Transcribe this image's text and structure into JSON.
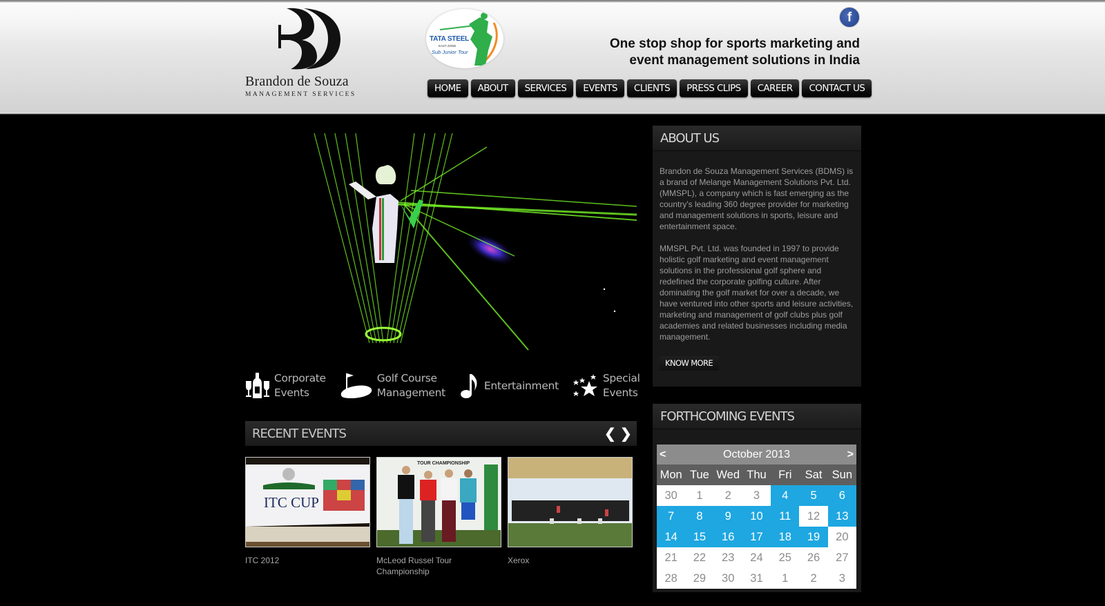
{
  "brand": {
    "name": "Brandon de Souza",
    "subtitle": "MANAGEMENT SERVICES",
    "partner_badge": {
      "line1": "TATA STEEL",
      "line2": "EAST ZONE",
      "line3": "Sub Junior Tour"
    }
  },
  "header": {
    "social_icon": "facebook-icon",
    "social_label": "f",
    "tagline_line1": "One stop shop for sports marketing and",
    "tagline_line2": "event management solutions in India"
  },
  "nav": {
    "items": [
      {
        "label": "HOME"
      },
      {
        "label": "ABOUT"
      },
      {
        "label": "SERVICES"
      },
      {
        "label": "EVENTS"
      },
      {
        "label": "CLIENTS"
      },
      {
        "label": "PRESS CLIPS"
      },
      {
        "label": "CAREER"
      },
      {
        "label": "CONTACT US"
      }
    ]
  },
  "services": [
    {
      "icon": "wine-glasses-icon",
      "line1": "Corporate",
      "line2": "Events"
    },
    {
      "icon": "golf-green-icon",
      "line1": "Golf Course",
      "line2": "Management"
    },
    {
      "icon": "music-note-icon",
      "line1": "Entertainment",
      "line2": ""
    },
    {
      "icon": "stars-icon",
      "line1": "Special",
      "line2": "Events"
    }
  ],
  "recent_events": {
    "title": "RECENT EVENTS",
    "prev": "❮",
    "next": "❯",
    "items": [
      {
        "caption": "ITC 2012",
        "image_text": "ITC CUP"
      },
      {
        "caption": "McLeod Russel Tour Championship",
        "image_text": "TOUR CHAMPIONSHIP"
      },
      {
        "caption": "Xerox",
        "image_text": ""
      }
    ]
  },
  "about": {
    "title": "ABOUT US",
    "para1": "Brandon de Souza Management Services (BDMS) is a brand of Melange Management Solutions Pvt. Ltd.(MMSPL), a company which is fast emerging as the country's leading 360 degree provider for marketing and management solutions in sports, leisure and entertainment space.",
    "para2": "MMSPL Pvt. Ltd. was founded in 1997 to provide holistic golf marketing and event management solutions in the professional golf sphere and redefined the corporate golfing culture. After dominating the golf market for over a decade, we have ventured into other sports and leisure activities, marketing and management of golf clubs plus golf academies and related businesses including media management.",
    "button": "KNOW MORE"
  },
  "forthcoming": {
    "title": "FORTHCOMING EVENTS",
    "calendar": {
      "month_label": "October 2013",
      "prev": "<",
      "next": ">",
      "weekdays": [
        "Mon",
        "Tue",
        "Wed",
        "Thu",
        "Fri",
        "Sat",
        "Sun"
      ],
      "highlight_color": "#1ea7e1",
      "weeks": [
        [
          {
            "d": "30",
            "ev": false
          },
          {
            "d": "1",
            "ev": false
          },
          {
            "d": "2",
            "ev": false
          },
          {
            "d": "3",
            "ev": false
          },
          {
            "d": "4",
            "ev": true
          },
          {
            "d": "5",
            "ev": true
          },
          {
            "d": "6",
            "ev": true
          }
        ],
        [
          {
            "d": "7",
            "ev": true
          },
          {
            "d": "8",
            "ev": true
          },
          {
            "d": "9",
            "ev": true
          },
          {
            "d": "10",
            "ev": true
          },
          {
            "d": "11",
            "ev": true
          },
          {
            "d": "12",
            "ev": false
          },
          {
            "d": "13",
            "ev": true
          }
        ],
        [
          {
            "d": "14",
            "ev": true
          },
          {
            "d": "15",
            "ev": true
          },
          {
            "d": "16",
            "ev": true
          },
          {
            "d": "17",
            "ev": true
          },
          {
            "d": "18",
            "ev": true
          },
          {
            "d": "19",
            "ev": true
          },
          {
            "d": "20",
            "ev": false
          }
        ],
        [
          {
            "d": "21",
            "ev": false
          },
          {
            "d": "22",
            "ev": false
          },
          {
            "d": "23",
            "ev": false
          },
          {
            "d": "24",
            "ev": false
          },
          {
            "d": "25",
            "ev": false
          },
          {
            "d": "26",
            "ev": false
          },
          {
            "d": "27",
            "ev": false
          }
        ],
        [
          {
            "d": "28",
            "ev": false
          },
          {
            "d": "29",
            "ev": false
          },
          {
            "d": "30",
            "ev": false
          },
          {
            "d": "31",
            "ev": false
          },
          {
            "d": "1",
            "ev": false
          },
          {
            "d": "2",
            "ev": false
          },
          {
            "d": "3",
            "ev": false
          }
        ]
      ]
    }
  }
}
